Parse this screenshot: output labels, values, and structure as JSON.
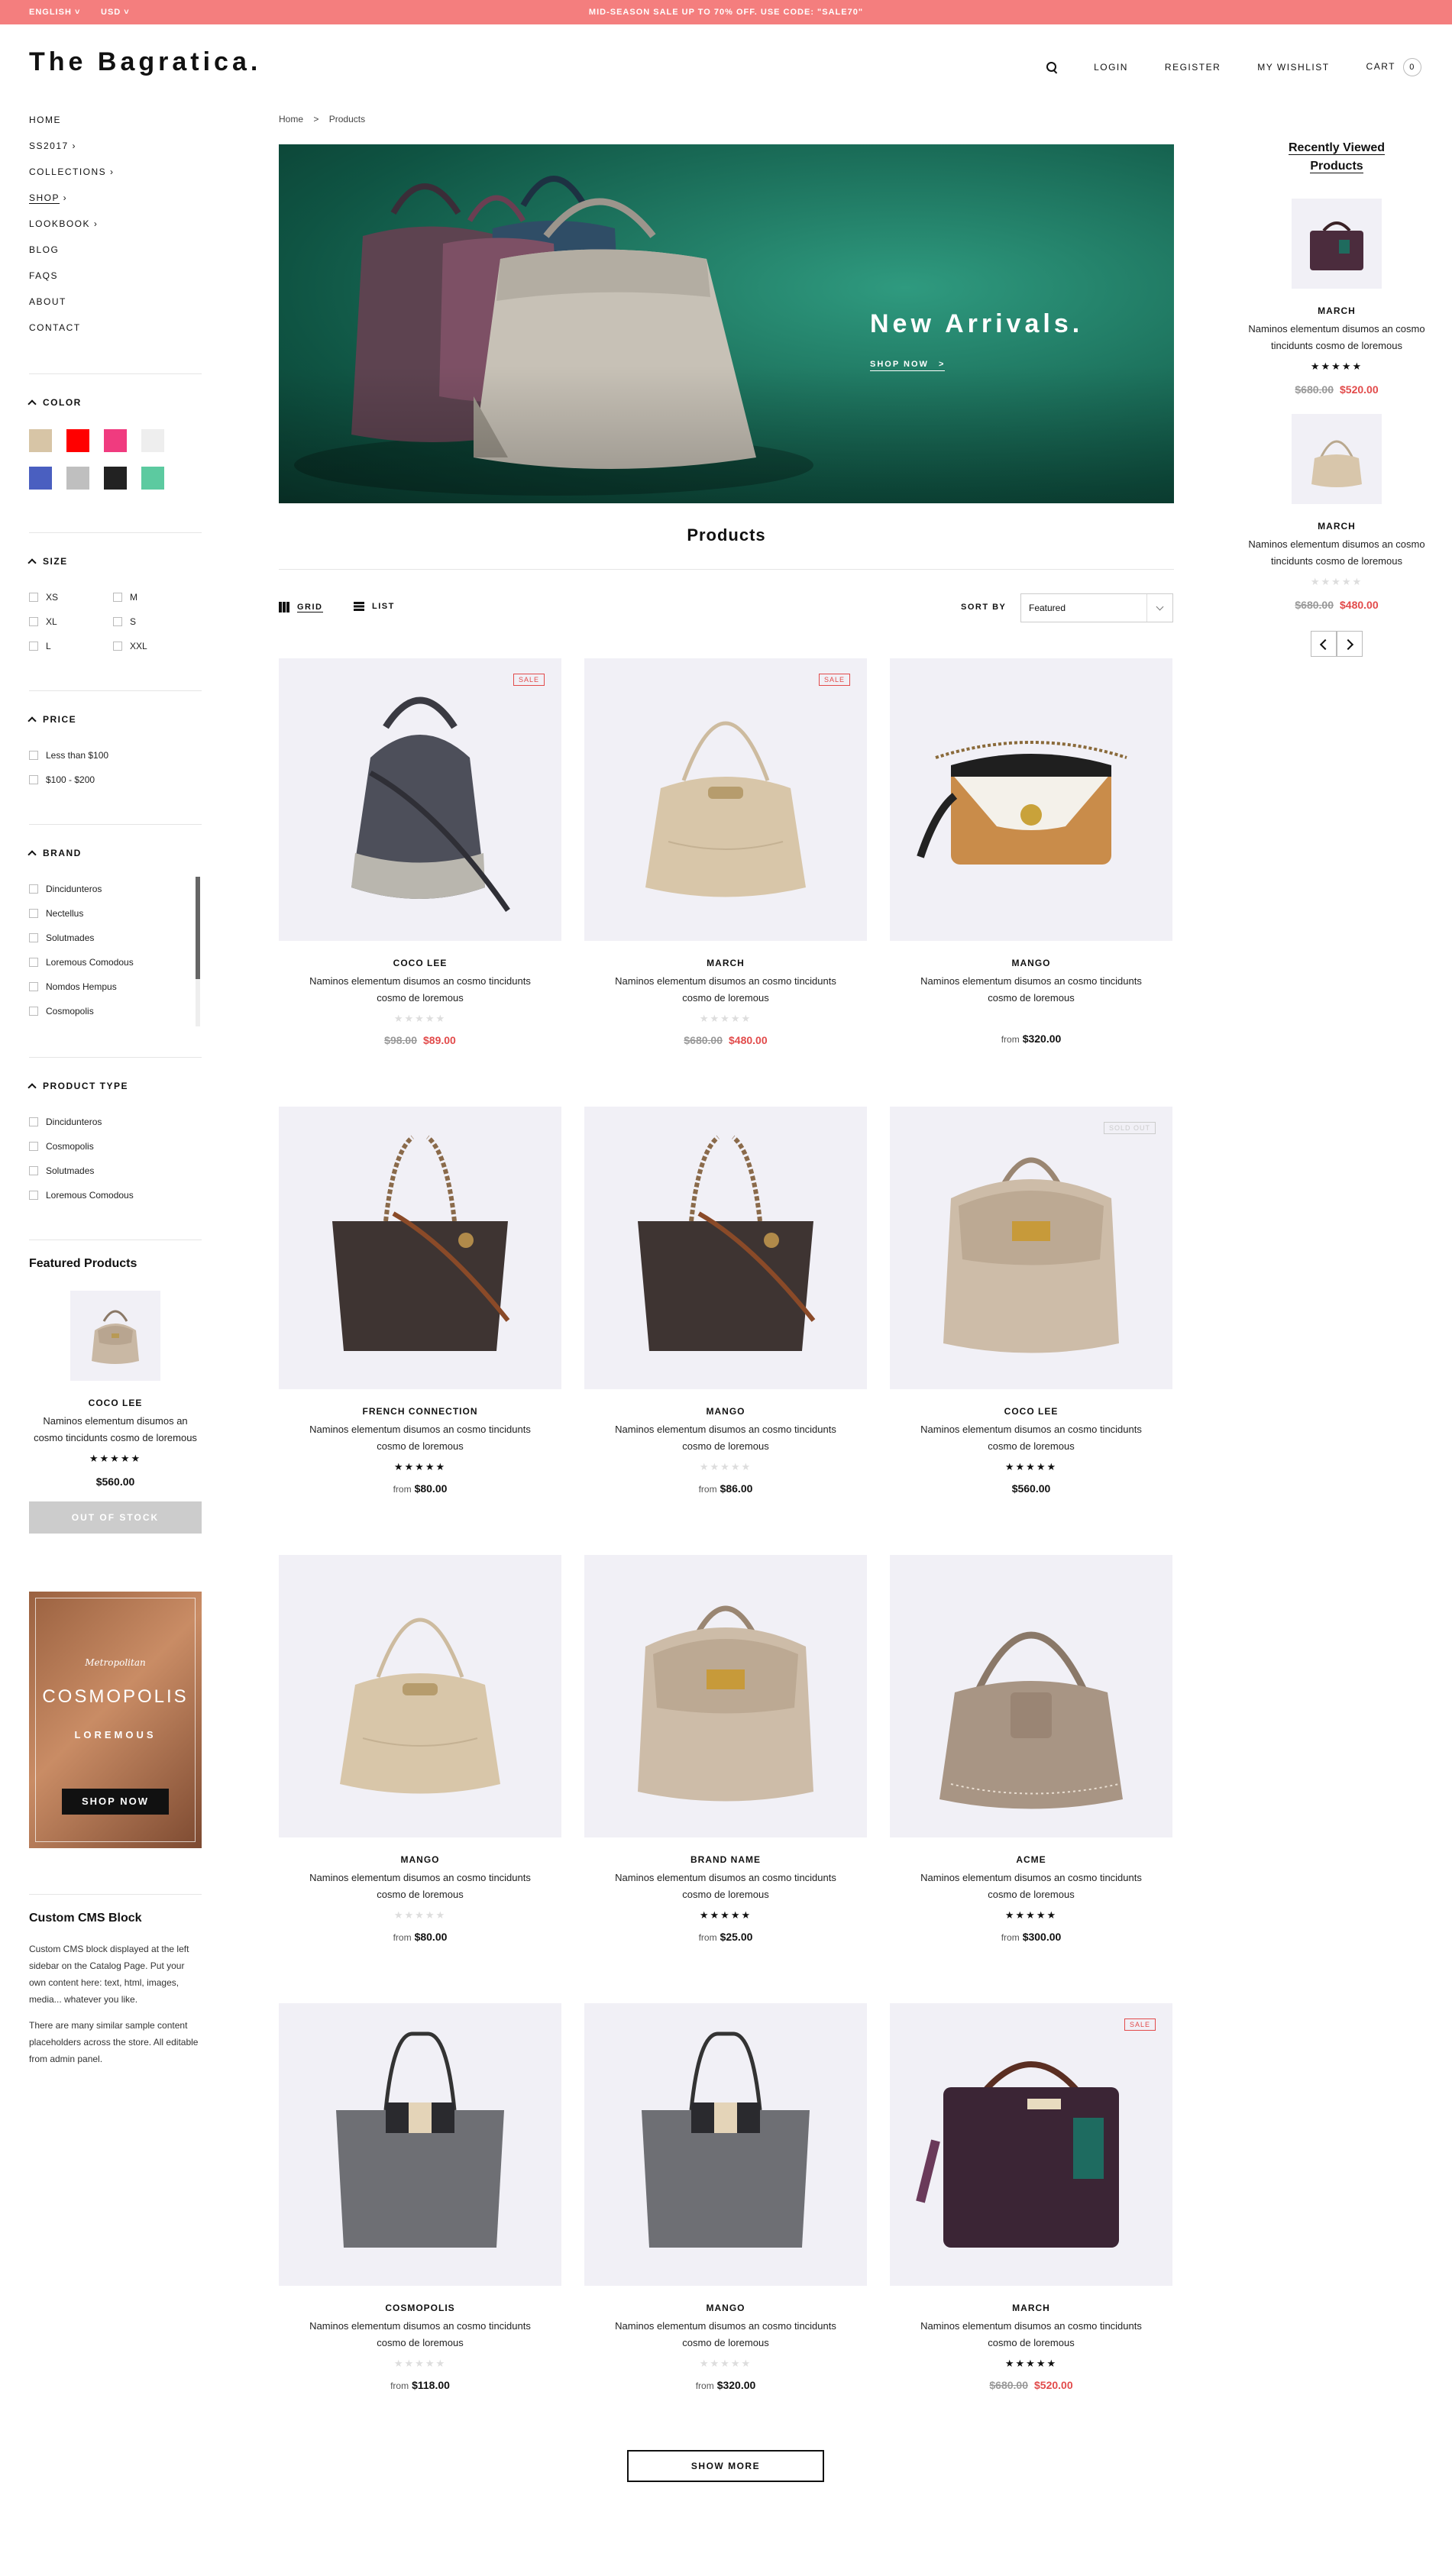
{
  "topbar": {
    "language": "ENGLISH",
    "currency": "USD",
    "promo": "MID-SEASON SALE UP TO 70% OFF. USE CODE: \"SALE70\""
  },
  "header": {
    "logo": "The Bagratica.",
    "login": "LOGIN",
    "register": "REGISTER",
    "wishlist": "MY WISHLIST",
    "cart": "CART",
    "cart_count": "0"
  },
  "sidebar": {
    "nav": [
      "HOME",
      "SS2017",
      "COLLECTIONS",
      "SHOP",
      "LOOKBOOK",
      "BLOG",
      "FAQS",
      "ABOUT",
      "CONTACT"
    ],
    "color_title": "COLOR",
    "colors": [
      "#d7c5a6",
      "#ff0000",
      "#f03b7f",
      "#eeeeee",
      "#4a5fc0",
      "#bfbfbf",
      "#222222",
      "#5ccaa0"
    ],
    "size_title": "SIZE",
    "sizes": [
      "XS",
      "M",
      "XL",
      "S",
      "L",
      "XXL"
    ],
    "price_title": "PRICE",
    "prices": [
      "Less than $100",
      "$100 - $200"
    ],
    "brand_title": "BRAND",
    "brands": [
      "Dincidunteros",
      "Nectellus",
      "Solutmades",
      "Loremous Comodous",
      "Nomdos Hempus",
      "Cosmopolis"
    ],
    "type_title": "PRODUCT TYPE",
    "types": [
      "Dincidunteros",
      "Cosmopolis",
      "Solutmades",
      "Loremous Comodous"
    ],
    "featured_title": "Featured Products",
    "featured": {
      "name": "COCO LEE",
      "desc": "Naminos elementum disumos an cosmo tincidunts cosmo de loremous",
      "stars": "★★★★★",
      "price": "$560.00",
      "button": "OUT OF STOCK"
    },
    "banner": {
      "script": "Metropolitan",
      "title": "COSMOPOLIS",
      "subtitle": "LOREMOUS",
      "button": "SHOP NOW"
    },
    "cms_title": "Custom CMS Block",
    "cms_p1": "Custom CMS block displayed at the left sidebar on the Catalog Page. Put your own content here: text, html, images, media... whatever you like.",
    "cms_p2": "There are many similar sample content placeholders across the store. All editable from admin panel."
  },
  "breadcrumb": {
    "home": "Home",
    "sep": ">",
    "current": "Products"
  },
  "hero": {
    "title": "New Arrivals.",
    "link": "SHOP NOW",
    "link_arrow": ">"
  },
  "main": {
    "title": "Products",
    "grid": "GRID",
    "list": "LIST",
    "sort_label": "SORT BY",
    "sort_value": "Featured",
    "show_more": "SHOW MORE"
  },
  "products": [
    {
      "name": "COCO LEE",
      "desc": "Naminos elementum disumos an cosmo tincidunts cosmo de loremous",
      "stars": "★★★★★",
      "rated": false,
      "old": "$98.00",
      "price": "$89.00",
      "from": "",
      "badge": "SALE",
      "bag": "hobo-grey"
    },
    {
      "name": "MARCH",
      "desc": "Naminos elementum disumos an cosmo tincidunts cosmo de loremous",
      "stars": "★★★★★",
      "rated": false,
      "old": "$680.00",
      "price": "$480.00",
      "from": "",
      "badge": "SALE",
      "bag": "shoulder-beige"
    },
    {
      "name": "MANGO",
      "desc": "Naminos elementum disumos an cosmo tincidunts cosmo de loremous",
      "stars": "",
      "rated": false,
      "old": "",
      "price": "$320.00",
      "from": "from",
      "badge": "",
      "bag": "crossbody-tan"
    },
    {
      "name": "FRENCH CONNECTION",
      "desc": "Naminos elementum disumos an cosmo tincidunts cosmo de loremous",
      "stars": "★★★★★",
      "rated": true,
      "old": "",
      "price": "$80.00",
      "from": "from",
      "badge": "",
      "bag": "tote-brown"
    },
    {
      "name": "MANGO",
      "desc": "Naminos elementum disumos an cosmo tincidunts cosmo de loremous",
      "stars": "★★★★★",
      "rated": false,
      "old": "",
      "price": "$86.00",
      "from": "from",
      "badge": "",
      "bag": "tote-brown"
    },
    {
      "name": "COCO LEE",
      "desc": "Naminos elementum disumos an cosmo tincidunts cosmo de loremous",
      "stars": "★★★★★",
      "rated": true,
      "old": "",
      "price": "$560.00",
      "from": "",
      "badge": "SOLD OUT",
      "bag": "backpack-taupe"
    },
    {
      "name": "MANGO",
      "desc": "Naminos elementum disumos an cosmo tincidunts cosmo de loremous",
      "stars": "★★★★★",
      "rated": false,
      "old": "",
      "price": "$80.00",
      "from": "from",
      "badge": "",
      "bag": "shoulder-beige"
    },
    {
      "name": "BRAND NAME",
      "desc": "Naminos elementum disumos an cosmo tincidunts cosmo de loremous",
      "stars": "★★★★★",
      "rated": true,
      "old": "",
      "price": "$25.00",
      "from": "from",
      "badge": "",
      "bag": "backpack-taupe"
    },
    {
      "name": "ACME",
      "desc": "Naminos elementum disumos an cosmo tincidunts cosmo de loremous",
      "stars": "★★★★★",
      "rated": true,
      "old": "",
      "price": "$300.00",
      "from": "from",
      "badge": "",
      "bag": "hobo-taupe"
    },
    {
      "name": "COSMOPOLIS",
      "desc": "Naminos elementum disumos an cosmo tincidunts cosmo de loremous",
      "stars": "★★★★★",
      "rated": false,
      "old": "",
      "price": "$118.00",
      "from": "from",
      "badge": "",
      "bag": "tote-grey"
    },
    {
      "name": "MANGO",
      "desc": "Naminos elementum disumos an cosmo tincidunts cosmo de loremous",
      "stars": "★★★★★",
      "rated": false,
      "old": "",
      "price": "$320.00",
      "from": "from",
      "badge": "",
      "bag": "tote-grey"
    },
    {
      "name": "MARCH",
      "desc": "Naminos elementum disumos an cosmo tincidunts cosmo de loremous",
      "stars": "★★★★★",
      "rated": true,
      "old": "$680.00",
      "price": "$520.00",
      "from": "",
      "badge": "SALE",
      "bag": "briefcase-purple"
    }
  ],
  "recent": {
    "title_1": "Recently Viewed",
    "title_2": "Products",
    "items": [
      {
        "name": "MARCH",
        "desc": "Naminos elementum disumos an cosmo tincidunts cosmo de loremous",
        "stars": "★★★★★",
        "rated": true,
        "old": "$680.00",
        "price": "$520.00"
      },
      {
        "name": "MARCH",
        "desc": "Naminos elementum disumos an cosmo tincidunts cosmo de loremous",
        "stars": "★★★★★",
        "rated": false,
        "old": "$680.00",
        "price": "$480.00"
      }
    ]
  }
}
